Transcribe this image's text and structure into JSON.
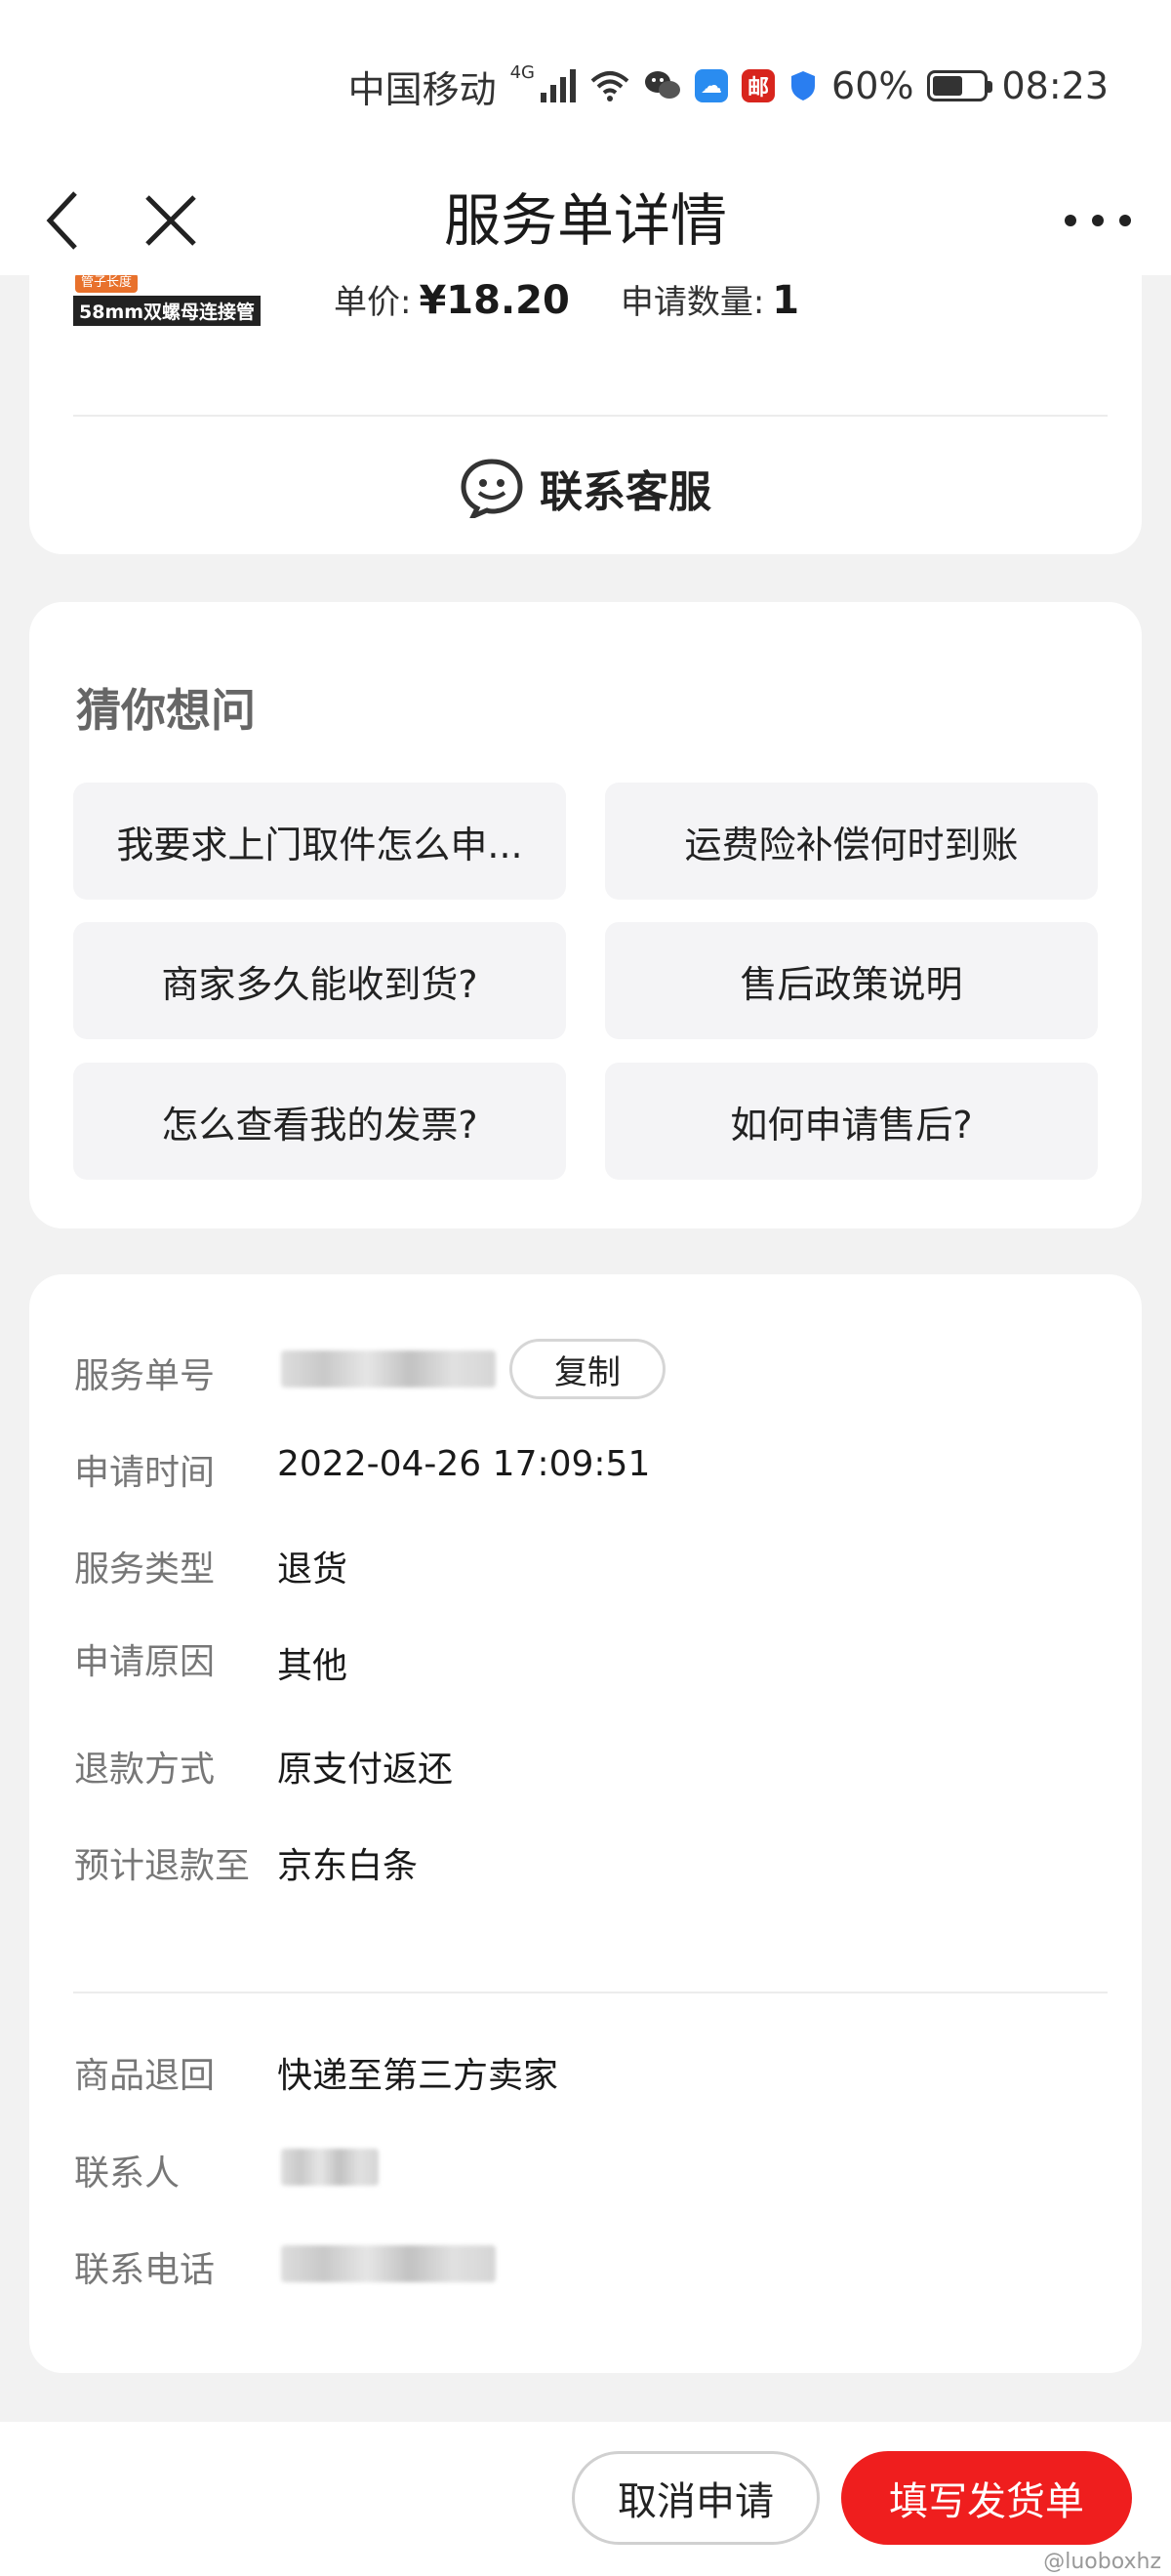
{
  "status_bar": {
    "carrier": "中国移动",
    "network": "4G",
    "battery": "60%",
    "battery_level": 0.6,
    "time": "08:23",
    "icons": [
      "signal-icon",
      "wifi-icon",
      "wechat-icon",
      "cloud-icon",
      "post-icon",
      "shield-icon",
      "battery-icon"
    ]
  },
  "nav": {
    "title": "服务单详情",
    "back_icon": "chevron-left-icon",
    "close_icon": "close-icon",
    "more_icon": "more-icon"
  },
  "product": {
    "thumb_tag": "管子长度",
    "thumb_label": "58mm双螺母连接管",
    "unit_price_label": "单价:",
    "unit_price": "¥18.20",
    "quantity_label": "申请数量:",
    "quantity": "1"
  },
  "contact": {
    "label": "联系客服",
    "icon": "customer-service-icon"
  },
  "faq": {
    "title": "猜你想问",
    "items": [
      "我要求上门取件怎么申...",
      "运费险补偿何时到账",
      "商家多久能收到货?",
      "售后政策说明",
      "怎么查看我的发票?",
      "如何申请售后?"
    ]
  },
  "details": {
    "service_no_label": "服务单号",
    "copy_label": "复制",
    "apply_time_label": "申请时间",
    "apply_time": "2022-04-26 17:09:51",
    "service_type_label": "服务类型",
    "service_type": "退货",
    "reason_label": "申请原因",
    "reason": "其他",
    "refund_method_label": "退款方式",
    "refund_method": "原支付返还",
    "refund_to_label": "预计退款至",
    "refund_to": "京东白条",
    "return_label": "商品退回",
    "return_value": "快递至第三方卖家",
    "contact_person_label": "联系人",
    "contact_phone_label": "联系电话"
  },
  "actions": {
    "cancel": "取消申请",
    "ship": "填写发货单"
  },
  "watermark": "@luoboxhz",
  "colors": {
    "accent": "#ef1e1e",
    "background": "#f2f2f2",
    "card": "#ffffff"
  }
}
